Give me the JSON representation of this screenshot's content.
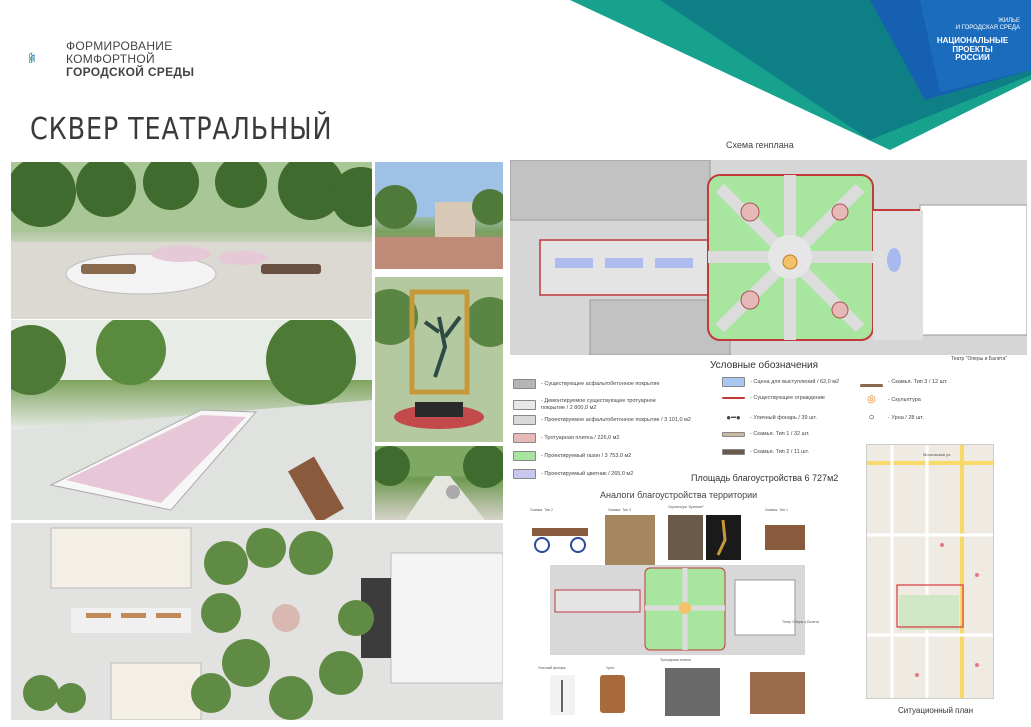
{
  "header": {
    "logo_lines": [
      "ФОРМИРОВАНИЕ",
      "КОМФОРТНОЙ",
      "ГОРОДСКОЙ СРЕДЫ"
    ],
    "np_small": [
      "ЖИЛЬЕ",
      "И ГОРОДСКАЯ СРЕДА"
    ],
    "np_big": [
      "НАЦИОНАЛЬНЫЕ",
      "ПРОЕКТЫ",
      "РОССИИ"
    ],
    "title": "СКВЕР ТЕАТРАЛЬНЫЙ",
    "colors": {
      "teal": "#1fa89a",
      "blue": "#1560b0",
      "dark_teal": "#0d6f7a"
    }
  },
  "plan": {
    "caption": "Схема генплана",
    "theatre_label": "Театр \"Оперы и Балета\""
  },
  "legend": {
    "title": "Условные обозначения",
    "left": [
      {
        "text": "- Существующее асфальтобетонное покрытие",
        "color": "#b5b5b5"
      },
      {
        "text": "- Демонтируемое существующее тротуарное покрытие / 2 800,0 м2",
        "color": "#e8e8e8"
      },
      {
        "text": "- Проектируемое асфальтобетонное покрытие / 3 101,0 м2",
        "color": "#d9d9d9"
      },
      {
        "text": "- Тротуарная плитка / 226,0 м2",
        "color": "#e6b8b8"
      },
      {
        "text": "- Проектируемый газон / 3 753,0 м2",
        "color": "#a8e6a0"
      },
      {
        "text": "- Проектируемый цветник / 265,0 м2",
        "color": "#c7c7f0"
      }
    ],
    "middle": [
      {
        "text": "- Сцена для выступлений / 62,0 м2",
        "icon": "stage-icon"
      },
      {
        "text": "- Существующее ограждение",
        "icon": "fence-icon"
      },
      {
        "text": "- Уличный фонарь / 39 шт.",
        "icon": "lamp-icon"
      },
      {
        "text": "- Скамья. Тип 1 / 32 шт.",
        "icon": "bench1-icon"
      },
      {
        "text": "- Скамья. Тип 2 / 11 шт.",
        "icon": "bench2-icon"
      }
    ],
    "right": [
      {
        "text": "- Скамья. Тип 3 / 12 шт.",
        "icon": "bench3-icon"
      },
      {
        "text": "- Скульптура",
        "icon": "sculpture-icon"
      },
      {
        "text": "- Урна / 28 шт.",
        "icon": "urn-icon"
      }
    ],
    "area": "Площадь благоустройства 6 727м2"
  },
  "analogs": {
    "title": "Аналоги благоустройства территории",
    "labels": [
      "Скамья. Тип 2",
      "Скамья. Тип 3",
      "Скульптура \"Арлекин\"",
      "Скамья. Тип 1",
      "Уличный фонарь",
      "Урна",
      "Тротуарная плитка",
      "Театр Оперы и Балета"
    ]
  },
  "map": {
    "caption": "Ситуационный план",
    "street": "Московская ул."
  }
}
